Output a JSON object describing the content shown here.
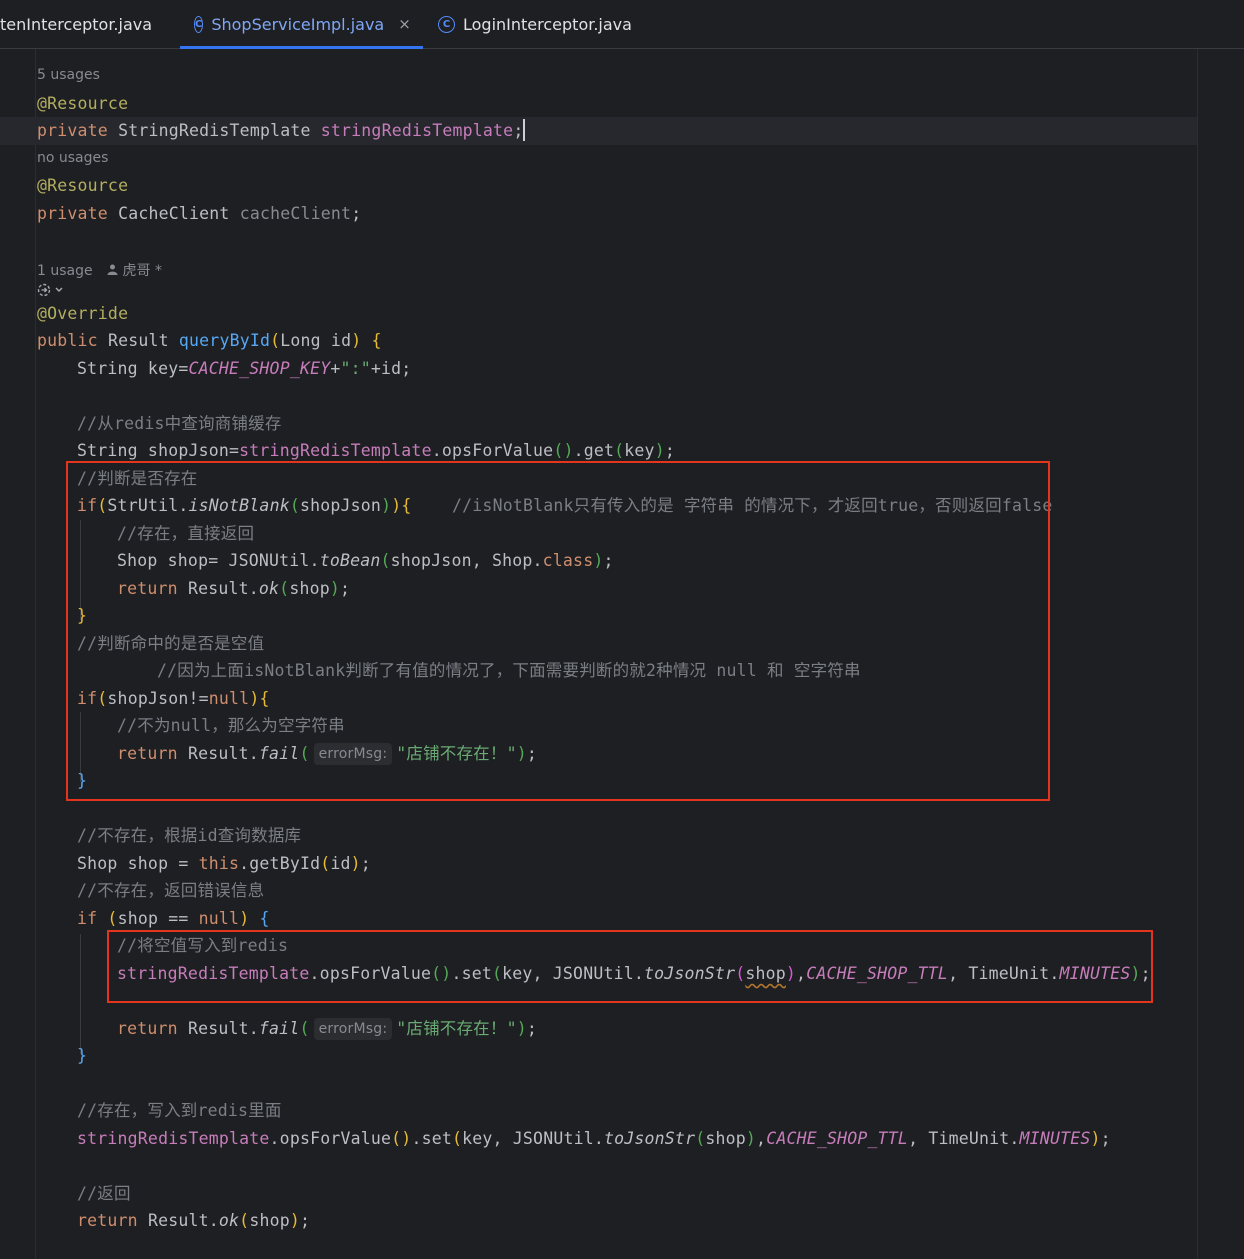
{
  "tabs": [
    {
      "label": "tenInterceptor.java",
      "active": false,
      "icon": "none"
    },
    {
      "label": "ShopServiceImpl.java",
      "active": true,
      "icon": "class-icon"
    },
    {
      "label": "LoginInterceptor.java",
      "active": false,
      "icon": "class-icon"
    }
  ],
  "tab_close_glyph": "×",
  "hints": {
    "usages_1": "5 usages",
    "usages_2": "no usages",
    "usages_3": "1 usage",
    "author": "虎哥 *"
  },
  "code": {
    "l1_ann": "@Resource",
    "l2_kw": "private",
    "l2_type": "StringRedisTemplate",
    "l2_field": "stringRedisTemplate",
    "l4_ann": "@Resource",
    "l5_kw": "private",
    "l5_type": "CacheClient",
    "l5_field": "cacheClient",
    "l8_ann": "@Override",
    "l9_kw": "public",
    "l9_type": "Result",
    "l9_fn": "queryById",
    "l9_params": "Long id",
    "l10_decl": "String key=",
    "l10_const": "CACHE_SHOP_KEY",
    "l10_str": "\":\"",
    "l10_rest": "+id;",
    "c1": "//从redis中查询商铺缓存",
    "l12_decl": "String shopJson=",
    "l12_field": "stringRedisTemplate",
    "l12_m1": ".opsForValue",
    "l12_m2": ".get",
    "l12_arg": "key",
    "c2": "//判断是否存在",
    "l14_if": "if",
    "l14_cls": "StrUtil.",
    "l14_m": "isNotBlank",
    "l14_arg": "shopJson",
    "c3": "//isNotBlank只有传入的是 字符串 的情况下，才返回true，否则返回false",
    "c4": "//存在，直接返回",
    "l16_a": "Shop shop= JSONUtil.",
    "l16_m": "toBean",
    "l16_arg": "shopJson, Shop.",
    "l16_kw": "class",
    "l17_kw": "return",
    "l17_a": "Result.",
    "l17_m": "ok",
    "l17_arg": "shop",
    "c5": "//判断命中的是否是空值",
    "c6": "//因为上面isNotBlank判断了有值的情况了，下面需要判断的就2种情况 null 和 空字符串",
    "l21_if": "if",
    "l21_a": "shopJson!=",
    "l21_null": "null",
    "c7": "//不为null，那么为空字符串",
    "l23_kw": "return",
    "l23_a": "Result.",
    "l23_m": "fail",
    "inlay_param": "errorMsg:",
    "l23_str": "\"店铺不存在！\"",
    "c8": "//不存在，根据id查询数据库",
    "l27_a": "Shop shop = ",
    "l27_this": "this",
    "l27_b": ".getById",
    "l27_arg": "id",
    "c9": "//不存在，返回错误信息",
    "l29_if": "if",
    "l29_a": "shop == ",
    "l29_null": "null",
    "c10": "//将空值写入到redis",
    "l31_field": "stringRedisTemplate",
    "l31_m1": ".opsForValue",
    "l31_m2": ".set",
    "l31_a": "key, JSONUtil.",
    "l31_m3": "toJsonStr",
    "l31_arg": "shop",
    "l31_const": "CACHE_SHOP_TTL",
    "l31_b": ", TimeUnit.",
    "l31_const2": "MINUTES",
    "l33_kw": "return",
    "l33_a": "Result.",
    "l33_m": "fail",
    "l33_str": "\"店铺不存在！\"",
    "c11": "//存在，写入到redis里面",
    "l37_field": "stringRedisTemplate",
    "l37_m1": ".opsForValue",
    "l37_m2": ".set",
    "l37_a": "key, JSONUtil.",
    "l37_m3": "toJsonStr",
    "l37_arg": "shop",
    "l37_const": "CACHE_SHOP_TTL",
    "l37_b": ", TimeUnit.",
    "l37_const2": "MINUTES",
    "c12": "//返回",
    "l40_kw": "return",
    "l40_a": "Result.",
    "l40_m": "ok",
    "l40_arg": "shop"
  },
  "colors": {
    "background": "#1e1f22",
    "keyword": "#cf8e6d",
    "annotation": "#b3ae60",
    "field": "#c77dbb",
    "function": "#56a8f5",
    "string": "#6aab73",
    "comment": "#7a7e85",
    "highlight_box": "#e3341e"
  }
}
